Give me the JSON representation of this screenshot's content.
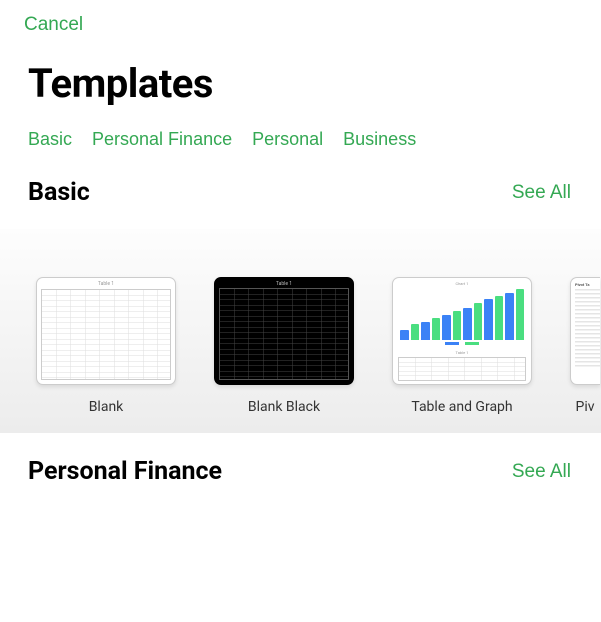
{
  "header": {
    "cancel_label": "Cancel"
  },
  "title": "Templates",
  "categories": [
    {
      "label": "Basic"
    },
    {
      "label": "Personal Finance"
    },
    {
      "label": "Personal"
    },
    {
      "label": "Business"
    }
  ],
  "sections": {
    "basic": {
      "title": "Basic",
      "see_all_label": "See All",
      "templates": [
        {
          "label": "Blank"
        },
        {
          "label": "Blank Black"
        },
        {
          "label": "Table and Graph"
        },
        {
          "label": "Piv"
        }
      ]
    },
    "finance": {
      "title": "Personal Finance",
      "see_all_label": "See All"
    }
  },
  "colors": {
    "accent": "#34a853"
  }
}
